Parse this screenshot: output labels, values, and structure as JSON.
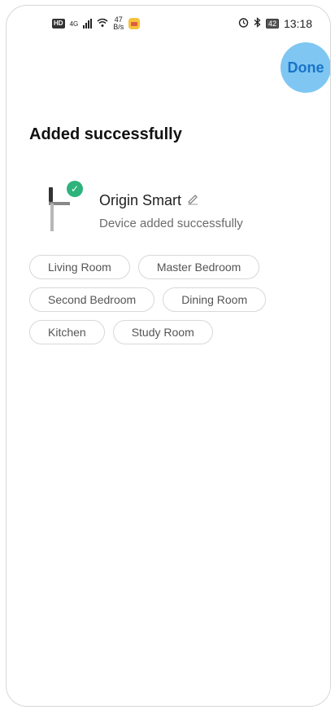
{
  "status_bar": {
    "hd": "HD",
    "network": "4G",
    "speed_value": "47",
    "speed_unit": "B/s",
    "battery": "42",
    "time": "13:18",
    "alarm_icon": "alarm-icon",
    "bluetooth_icon": "bluetooth-icon"
  },
  "header": {
    "done_label": "Done",
    "done_bg": "#7fc7f2",
    "done_color": "#1a74c9"
  },
  "title": "Added successfully",
  "device": {
    "name": "Origin Smart",
    "subtitle": "Device added successfully",
    "edit_icon": "pencil-icon",
    "badge_icon": "check-icon",
    "badge_color": "#2db37b"
  },
  "rooms": {
    "rows": [
      [
        "Living Room",
        "Master Bedroom"
      ],
      [
        "Second Bedroom",
        "Dining Room"
      ],
      [
        "Kitchen",
        "Study Room"
      ]
    ]
  }
}
